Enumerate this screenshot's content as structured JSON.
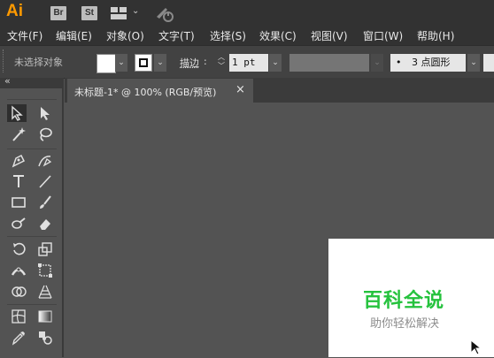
{
  "app": {
    "logo": "Ai",
    "bridge": "Br",
    "stock": "St"
  },
  "menu": [
    "文件(F)",
    "编辑(E)",
    "对象(O)",
    "文字(T)",
    "选择(S)",
    "效果(C)",
    "视图(V)",
    "窗口(W)",
    "帮助(H)"
  ],
  "control": {
    "selection_label": "未选择对象",
    "stroke_label": "描边",
    "stroke_colon": ":",
    "stroke_value": "1 pt",
    "brush_label": "3 点圆形",
    "brush_dot": "•"
  },
  "panel": {
    "collapse": "«"
  },
  "document": {
    "tab_title": "未标题-1* @ 100% (RGB/预览)",
    "close": "×"
  },
  "artboard": {
    "watermark_title": "百科全说",
    "watermark_subtitle": "助你轻松解决"
  },
  "colors": {
    "accent_logo": "#ff9a00",
    "watermark_green": "#25c23d"
  },
  "icons": [
    "selection-tool-icon",
    "direct-selection-tool-icon",
    "magic-wand-tool-icon",
    "lasso-tool-icon",
    "pen-tool-icon",
    "curvature-tool-icon",
    "type-tool-icon",
    "line-segment-tool-icon",
    "rectangle-tool-icon",
    "paintbrush-tool-icon",
    "blob-brush-tool-icon",
    "eraser-tool-icon",
    "rotate-tool-icon",
    "scale-tool-icon",
    "width-tool-icon",
    "free-transform-tool-icon",
    "shape-builder-tool-icon",
    "perspective-grid-tool-icon",
    "mesh-tool-icon",
    "gradient-tool-icon",
    "eyedropper-tool-icon",
    "blend-tool-icon"
  ]
}
